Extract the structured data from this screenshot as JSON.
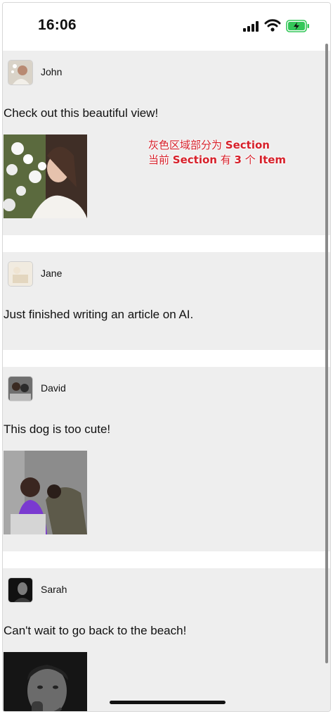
{
  "status_bar": {
    "time": "16:06"
  },
  "annotation": {
    "line1_pre": "灰色区域部分为 ",
    "line1_bold": "Section",
    "line2_pre": "当前 ",
    "line2_bold1": "Section",
    "line2_mid": " 有 ",
    "line2_bold2": "3",
    "line2_mid2": " 个 ",
    "line2_bold3": "Item"
  },
  "posts": [
    {
      "user": "John",
      "text": "Check out this beautiful view!",
      "has_photo": true
    },
    {
      "user": "Jane",
      "text": "Just finished writing an article on AI.",
      "has_photo": false
    },
    {
      "user": "David",
      "text": "This dog is too cute!",
      "has_photo": true
    },
    {
      "user": "Sarah",
      "text": "Can't wait to go back to the beach!",
      "has_photo": true
    }
  ]
}
